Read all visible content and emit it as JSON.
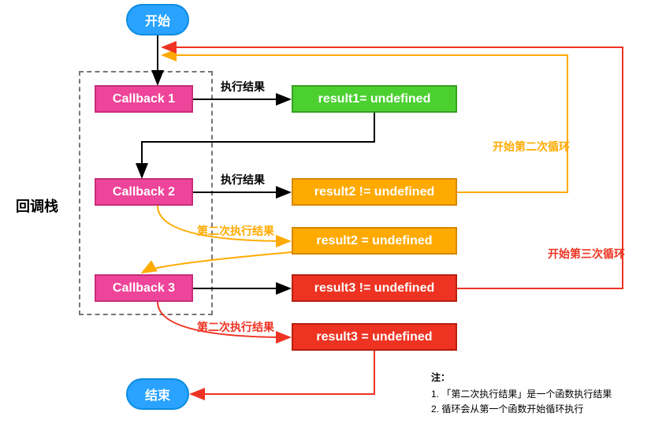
{
  "nodes": {
    "start": "开始",
    "end": "结束",
    "cb1": "Callback 1",
    "cb2": "Callback 2",
    "cb3": "Callback 3",
    "r1": "result1= undefined",
    "r2a": "result2 != undefined",
    "r2b": "result2 = undefined",
    "r3a": "result3 != undefined",
    "r3b": "result3 = undefined"
  },
  "labels": {
    "stack": "回调栈",
    "exec1": "执行结果",
    "exec2": "执行结果",
    "second_exec_a": "第二次执行结果",
    "second_exec_b": "第二次执行结果",
    "loop2": "开始第二次循环",
    "loop3": "开始第三次循环"
  },
  "notes": {
    "title": "注：",
    "n1": "1. 「第二次执行结果」是一个函数执行结果",
    "n2": "2. 循环会从第一个函数开始循环执行"
  },
  "colors": {
    "blue": "#29a3ff",
    "pink": "#ee4499",
    "green": "#4cd030",
    "orange": "#ffaa00",
    "red": "#ee3322",
    "black": "#000000"
  }
}
